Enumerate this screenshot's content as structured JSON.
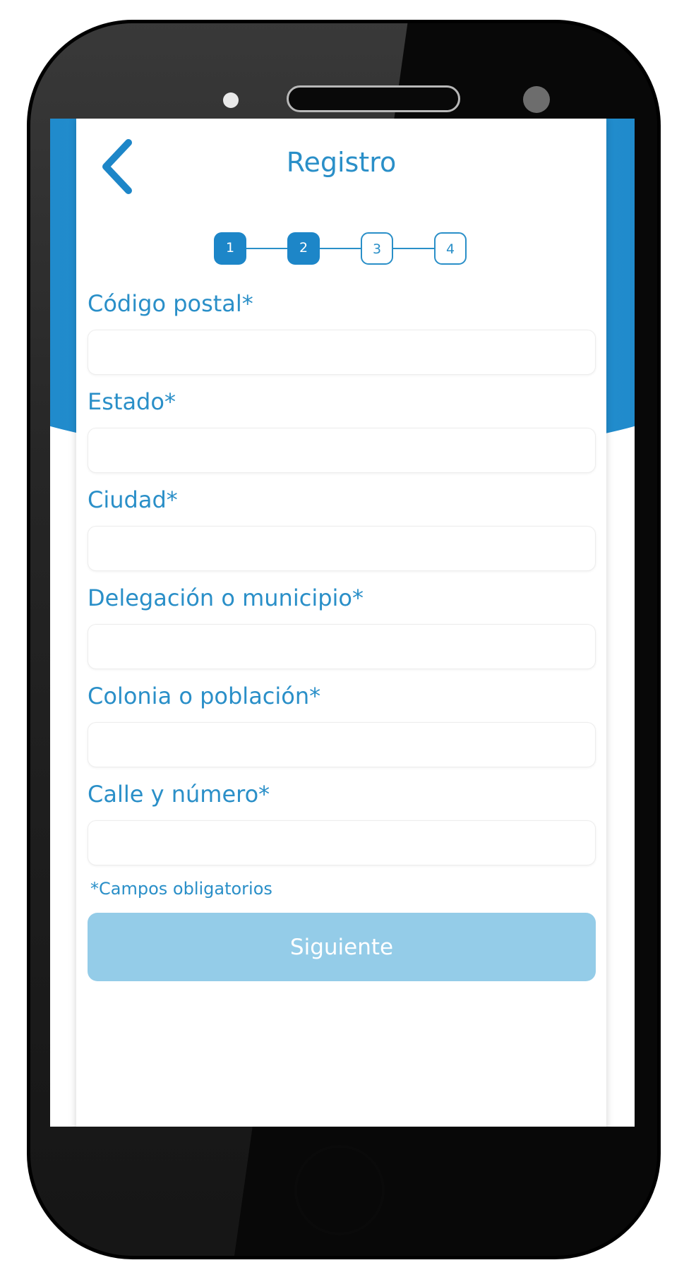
{
  "header": {
    "title": "Registro",
    "back_icon": "chevron-left-icon"
  },
  "stepper": {
    "steps": [
      "1",
      "2",
      "3",
      "4"
    ],
    "current_step": 2,
    "total_steps": 4
  },
  "form": {
    "fields": [
      {
        "label": "Código postal*",
        "value": ""
      },
      {
        "label": "Estado*",
        "value": ""
      },
      {
        "label": "Ciudad*",
        "value": ""
      },
      {
        "label": "Delegación o municipio*",
        "value": ""
      },
      {
        "label": "Colonia o población*",
        "value": ""
      },
      {
        "label": "Calle y número*",
        "value": ""
      }
    ],
    "required_note": "*Campos obligatorios",
    "next_button": "Siguiente"
  },
  "colors": {
    "accent": "#2a8fc8",
    "header_blue": "#1d86c8",
    "button_disabled": "#94cce8"
  }
}
